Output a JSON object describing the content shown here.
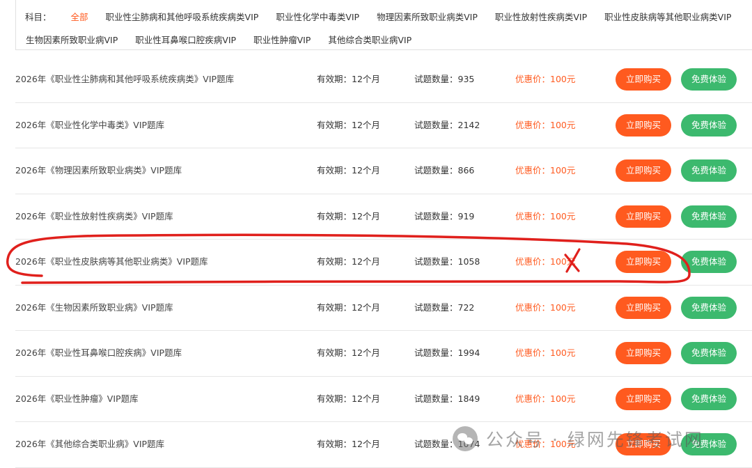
{
  "subjects": {
    "label": "科目：",
    "items": [
      {
        "label": "全部",
        "active": true
      },
      {
        "label": "职业性尘肺病和其他呼吸系统疾病类VIP"
      },
      {
        "label": "职业性化学中毒类VIP"
      },
      {
        "label": "物理因素所致职业病类VIP"
      },
      {
        "label": "职业性放射性疾病类VIP"
      },
      {
        "label": "职业性皮肤病等其他职业病类VIP"
      },
      {
        "label": "生物因素所致职业病VIP"
      },
      {
        "label": "职业性耳鼻喉口腔疾病VIP"
      },
      {
        "label": "职业性肿瘤VIP"
      },
      {
        "label": "其他综合类职业病VIP"
      }
    ]
  },
  "products": [
    {
      "title": "2026年《职业性尘肺病和其他呼吸系统疾病类》VIP题库",
      "validity": "有效期：12个月",
      "count": "试题数量：935",
      "price": "优惠价：100元",
      "buy": "立即购买",
      "trial": "免费体验"
    },
    {
      "title": "2026年《职业性化学中毒类》VIP题库",
      "validity": "有效期：12个月",
      "count": "试题数量：2142",
      "price": "优惠价：100元",
      "buy": "立即购买",
      "trial": "免费体验"
    },
    {
      "title": "2026年《物理因素所致职业病类》VIP题库",
      "validity": "有效期：12个月",
      "count": "试题数量：866",
      "price": "优惠价：100元",
      "buy": "立即购买",
      "trial": "免费体验"
    },
    {
      "title": "2026年《职业性放射性疾病类》VIP题库",
      "validity": "有效期：12个月",
      "count": "试题数量：919",
      "price": "优惠价：100元",
      "buy": "立即购买",
      "trial": "免费体验"
    },
    {
      "title": "2026年《职业性皮肤病等其他职业病类》VIP题库",
      "validity": "有效期：12个月",
      "count": "试题数量：1058",
      "price": "优惠价：100元",
      "buy": "立即购买",
      "trial": "免费体验"
    },
    {
      "title": "2026年《生物因素所致职业病》VIP题库",
      "validity": "有效期：12个月",
      "count": "试题数量：722",
      "price": "优惠价：100元",
      "buy": "立即购买",
      "trial": "免费体验"
    },
    {
      "title": "2026年《职业性耳鼻喉口腔疾病》VIP题库",
      "validity": "有效期：12个月",
      "count": "试题数量：1994",
      "price": "优惠价：100元",
      "buy": "立即购买",
      "trial": "免费体验"
    },
    {
      "title": "2026年《职业性肿瘤》VIP题库",
      "validity": "有效期：12个月",
      "count": "试题数量：1849",
      "price": "优惠价：100元",
      "buy": "立即购买",
      "trial": "免费体验"
    },
    {
      "title": "2026年《其他综合类职业病》VIP题库",
      "validity": "有效期：12个月",
      "count": "试题数量：1074",
      "price": "优惠价：100元",
      "buy": "立即购买",
      "trial": "免费体验"
    }
  ],
  "annotation": {
    "color": "#e0201c",
    "mark": "X"
  },
  "watermark": {
    "text": "公众号 · 绿网先锋考试网"
  },
  "colors": {
    "accent": "#ff5a1f",
    "trial": "#3cb96e"
  }
}
